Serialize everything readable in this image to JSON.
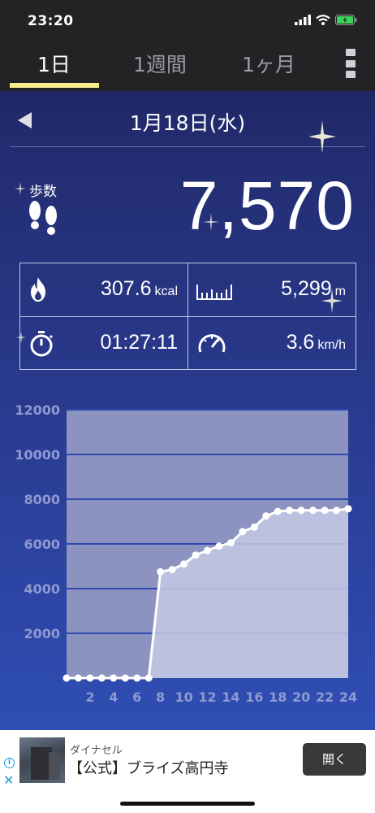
{
  "status_bar": {
    "time": "23:20"
  },
  "tabs": [
    {
      "label": "1日",
      "active": true
    },
    {
      "label": "1週間",
      "active": false
    },
    {
      "label": "1ヶ月",
      "active": false
    }
  ],
  "date": "1月18日(水)",
  "steps": {
    "label": "歩数",
    "value": "7,570"
  },
  "stats": {
    "calories": {
      "value": "307.6",
      "unit": "kcal"
    },
    "distance": {
      "value": "5,299",
      "unit": "m"
    },
    "time": {
      "value": "01:27:11"
    },
    "speed": {
      "value": "3.6",
      "unit": "km/h"
    }
  },
  "chart_data": {
    "type": "area",
    "title": "",
    "xlabel": "",
    "ylabel": "",
    "x_ticks": [
      "2",
      "4",
      "6",
      "8",
      "10",
      "12",
      "14",
      "16",
      "18",
      "20",
      "22",
      "24"
    ],
    "y_ticks": [
      "2000",
      "4000",
      "6000",
      "8000",
      "10000",
      "12000"
    ],
    "xlim": [
      0,
      24
    ],
    "ylim": [
      0,
      12000
    ],
    "grid": true,
    "series": [
      {
        "x": [
          0,
          1,
          2,
          3,
          4,
          5,
          6,
          7,
          8,
          9,
          10,
          11,
          12,
          13,
          14,
          15,
          16,
          17,
          18,
          19,
          20,
          21,
          22,
          23,
          24
        ],
        "values": [
          0,
          0,
          0,
          0,
          0,
          0,
          0,
          0,
          4750,
          4850,
          5100,
          5500,
          5700,
          5900,
          6050,
          6550,
          6750,
          7250,
          7450,
          7500,
          7500,
          7500,
          7500,
          7500,
          7570
        ]
      }
    ],
    "colors": {
      "fill": "#c4c9e4",
      "line": "#ffffff",
      "panel": "#8d93c0",
      "grid": "#2f4bb0"
    }
  },
  "ad": {
    "sponsor": "ダイナセル",
    "title": "【公式】ブライズ高円寺",
    "button": "開く"
  }
}
